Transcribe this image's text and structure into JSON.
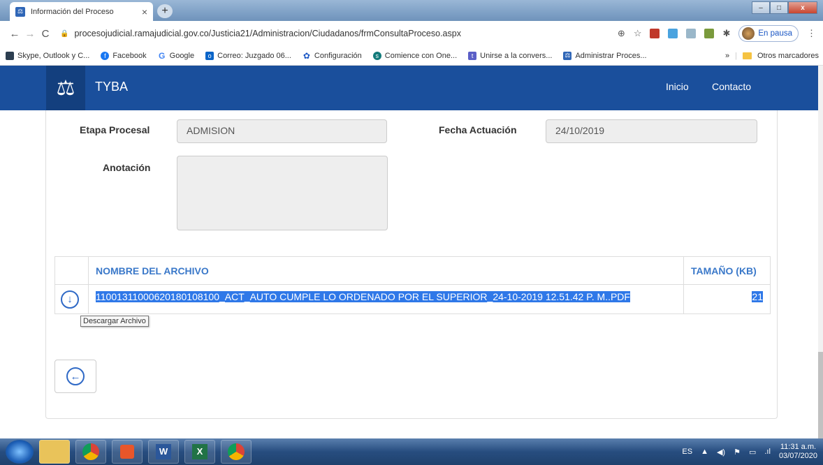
{
  "browser": {
    "tab_title": "Información del Proceso",
    "tab_close": "×",
    "new_tab": "+",
    "url": "procesojudicial.ramajudicial.gov.co/Justicia21/Administracion/Ciudadanos/frmConsultaProceso.aspx",
    "profile_status": "En pausa",
    "window_controls": {
      "minimize": "–",
      "maximize": "□",
      "close": "x"
    }
  },
  "bookmarks": {
    "items": [
      {
        "label": "Skype, Outlook y C...",
        "icon": "skype-icon",
        "color": "#2c3e50"
      },
      {
        "label": "Facebook",
        "icon": "facebook-icon",
        "color": "#1877f2"
      },
      {
        "label": "Google",
        "icon": "google-icon",
        "color": "#4285f4"
      },
      {
        "label": "Correo: Juzgado 06...",
        "icon": "outlook-icon",
        "color": "#0a64c8"
      },
      {
        "label": "Configuración",
        "icon": "gear-icon",
        "color": "#1a56c4"
      },
      {
        "label": "Comience con One...",
        "icon": "sharepoint-icon",
        "color": "#127a7a"
      },
      {
        "label": "Unirse a la convers...",
        "icon": "teams-icon",
        "color": "#5b5fc7"
      },
      {
        "label": "Administrar Proces...",
        "icon": "scales-icon",
        "color": "#2f66b7"
      }
    ],
    "more": "»",
    "other_folder": "Otros marcadores"
  },
  "navbar": {
    "brand": "TYBA",
    "links": [
      "Inicio",
      "Contacto"
    ],
    "color": "#1a4f9c"
  },
  "form": {
    "etapa_label": "Etapa Procesal",
    "etapa_value": "ADMISION",
    "fecha_label": "Fecha Actuación",
    "fecha_value": "24/10/2019",
    "anotacion_label": "Anotación",
    "anotacion_value": ""
  },
  "files_table": {
    "header_name": "NOMBRE DEL ARCHIVO",
    "header_size": "TAMAÑO (KB)",
    "rows": [
      {
        "name": "11001311000620180108100_ACT_AUTO CUMPLE LO ORDENADO POR EL SUPERIOR_24-10-2019 12.51.42 P. M..PDF",
        "size": "21"
      }
    ],
    "download_tooltip": "Descargar Archivo"
  },
  "taskbar": {
    "apps": [
      "explorer-icon",
      "chrome-icon",
      "media-player-icon",
      "word-icon",
      "excel-icon",
      "chrome-profile-icon"
    ],
    "language": "ES",
    "time": "11:31 a.m.",
    "date": "03/07/2020"
  }
}
